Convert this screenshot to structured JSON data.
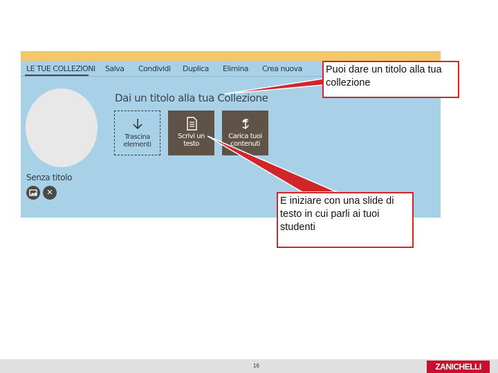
{
  "app": {
    "menu": [
      "LE TUE COLLEZIONI",
      "Salva",
      "Condividi",
      "Duplica",
      "Elimina",
      "Crea nuova"
    ],
    "collection_title": "Dai un titolo alla tua Collezione",
    "item_name": "Senza titolo",
    "tiles": {
      "drop": {
        "line1": "Trascina",
        "line2": "elementi",
        "icon": "download-arrow-icon"
      },
      "write": {
        "line1": "Scrivi un",
        "line2": "testo",
        "icon": "document-icon"
      },
      "upload": {
        "line1": "Carica tuoi",
        "line2": "contenuti",
        "icon": "upload-icon"
      }
    },
    "item_buttons": {
      "image_icon": "image-icon",
      "close_icon": "close-icon",
      "close_glyph": "✕"
    }
  },
  "callouts": {
    "title": "Puoi dare un titolo alla tua collezione",
    "slide": "E iniziare con una slide di testo in cui parli ai tuoi studenti"
  },
  "colors": {
    "panel_bg": "#a8d1e8",
    "top_strip": "#f3c76a",
    "tile_dark": "#5e5346",
    "callout_border": "#d0262a",
    "brand": "#c8102e"
  },
  "footer": {
    "page_number": "16",
    "brand": "ZANICHELLI"
  }
}
